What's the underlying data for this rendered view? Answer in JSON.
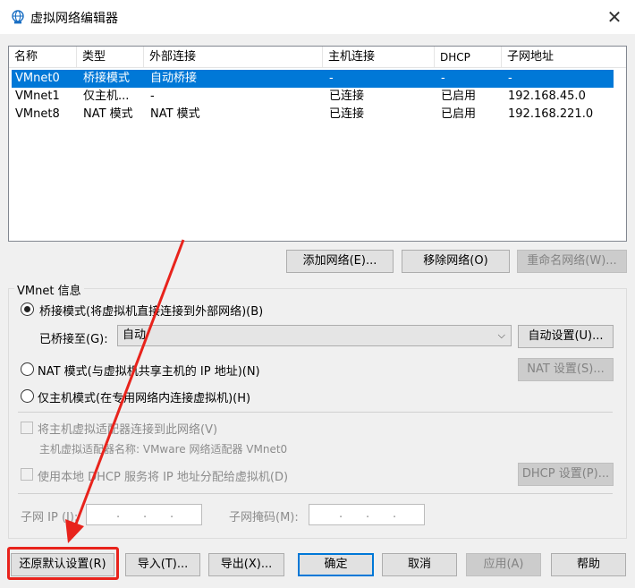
{
  "window": {
    "title": "虚拟网络编辑器",
    "close": "✕"
  },
  "table": {
    "headers": [
      "名称",
      "类型",
      "外部连接",
      "主机连接",
      "DHCP",
      "子网地址"
    ],
    "rows": [
      [
        "VMnet0",
        "桥接模式",
        "自动桥接",
        "-",
        "-",
        "-"
      ],
      [
        "VMnet1",
        "仅主机...",
        "-",
        "已连接",
        "已启用",
        "192.168.45.0"
      ],
      [
        "VMnet8",
        "NAT 模式",
        "NAT 模式",
        "已连接",
        "已启用",
        "192.168.221.0"
      ]
    ],
    "selected_row": 0
  },
  "list_buttons": {
    "add": "添加网络(E)...",
    "remove": "移除网络(O)",
    "rename": "重命名网络(W)..."
  },
  "vmnet_info": {
    "label": "VMnet 信息",
    "bridged": "桥接模式(将虚拟机直接连接到外部网络)(B)",
    "bridged_to_label": "已桥接至(G):",
    "bridged_to_value": "自动",
    "auto_settings": "自动设置(U)...",
    "nat": "NAT 模式(与虚拟机共享主机的 IP 地址)(N)",
    "nat_settings": "NAT 设置(S)...",
    "host_only": "仅主机模式(在专用网络内连接虚拟机)(H)",
    "connect_adapter": "将主机虚拟适配器连接到此网络(V)",
    "adapter_name": "主机虚拟适配器名称: VMware 网络适配器 VMnet0",
    "use_dhcp": "使用本地 DHCP 服务将 IP 地址分配给虚拟机(D)",
    "dhcp_settings": "DHCP 设置(P)...",
    "subnet_ip_label": "子网 IP (I):",
    "subnet_mask_label": "子网掩码(M):",
    "ip_dots": ".",
    "selected_mode": "bridged"
  },
  "footer": {
    "restore": "还原默认设置(R)",
    "import": "导入(T)...",
    "export": "导出(X)...",
    "ok": "确定",
    "cancel": "取消",
    "apply": "应用(A)",
    "help": "帮助"
  },
  "colors": {
    "selection": "#0078d7",
    "annotation": "#e8231c"
  }
}
